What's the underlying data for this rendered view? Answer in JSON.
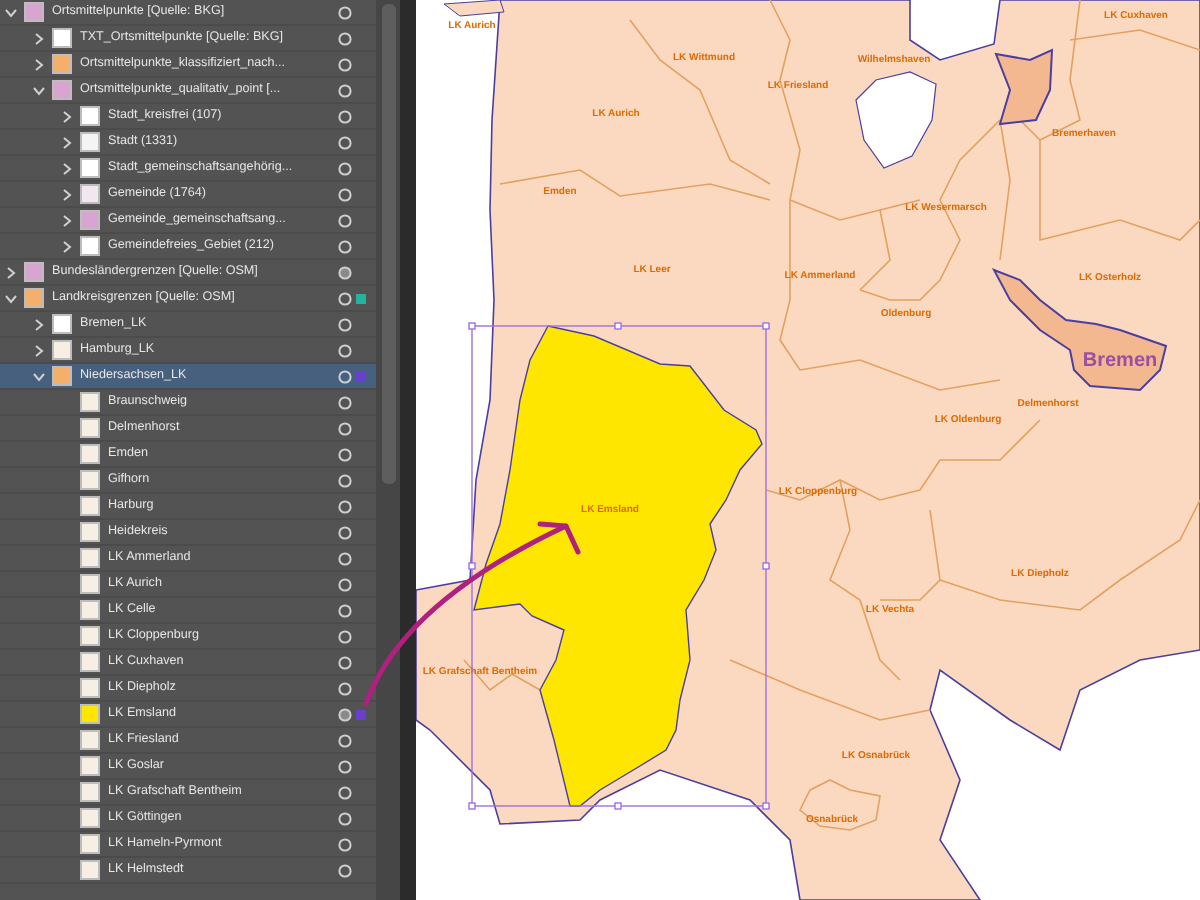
{
  "layers_panel": {
    "layers": [
      {
        "name": "Ortsmittelpunkte [Quelle: BKG]",
        "expanded": true,
        "selected": false,
        "thumb": {
          "color": "#d9a5d0"
        },
        "children": [
          {
            "name": "TXT_Ortsmittelpunkte [Quelle: BKG]",
            "expanded": false,
            "selected": false,
            "thumb": {
              "color": "#ffffff"
            }
          },
          {
            "name": "Ortsmittelpunkte_klassifiziert_nach...",
            "expanded": false,
            "selected": false,
            "thumb": {
              "color": "#f4b06a"
            }
          },
          {
            "name": "Ortsmittelpunkte_qualitativ_point [...",
            "expanded": true,
            "selected": false,
            "thumb": {
              "color": "#d9a5d0"
            },
            "children": [
              {
                "name": "Stadt_kreisfrei (107)",
                "expanded": false,
                "selected": false,
                "thumb": {
                  "color": "#ffffff"
                }
              },
              {
                "name": "Stadt (1331)",
                "expanded": false,
                "selected": false,
                "thumb": {
                  "color": "#f4f4f4"
                }
              },
              {
                "name": "Stadt_gemeinschaftsangehörig...",
                "expanded": false,
                "selected": false,
                "thumb": {
                  "color": "#ffffff"
                }
              },
              {
                "name": "Gemeinde (1764)",
                "expanded": false,
                "selected": false,
                "thumb": {
                  "color": "#f2e6f0"
                }
              },
              {
                "name": "Gemeinde_gemeinschaftsang...",
                "expanded": false,
                "selected": false,
                "thumb": {
                  "color": "#d9a5d0"
                }
              },
              {
                "name": "Gemeindefreies_Gebiet (212)",
                "expanded": false,
                "selected": false,
                "thumb": {
                  "color": "#ffffff"
                }
              }
            ]
          }
        ]
      },
      {
        "name": "Bundesländergrenzen [Quelle: OSM]",
        "expanded": false,
        "selected": false,
        "targeted": true,
        "thumb": {
          "color": "#d9a5d0"
        }
      },
      {
        "name": "Landkreisgrenzen [Quelle: OSM]",
        "expanded": true,
        "selected": false,
        "selection": {
          "color": "#21b5a0"
        },
        "thumb": {
          "color": "#f4b06a"
        },
        "children": [
          {
            "name": "Bremen_LK",
            "expanded": false,
            "selected": false,
            "thumb": {
              "color": "#ffffff"
            }
          },
          {
            "name": "Hamburg_LK",
            "expanded": false,
            "selected": false,
            "thumb": {
              "color": "#f7efe3"
            }
          },
          {
            "name": "Niedersachsen_LK",
            "expanded": true,
            "selected": true,
            "selection": {
              "color": "#6a3fd0"
            },
            "thumb": {
              "color": "#f4b06a"
            },
            "children": [
              {
                "name": "Braunschweig",
                "selected": false,
                "thumb": {
                  "color": "#f7efe3"
                }
              },
              {
                "name": "Delmenhorst",
                "selected": false,
                "thumb": {
                  "color": "#f7efe3"
                }
              },
              {
                "name": "Emden",
                "selected": false,
                "thumb": {
                  "color": "#f7efe3"
                }
              },
              {
                "name": "Gifhorn",
                "selected": false,
                "thumb": {
                  "color": "#f7efe3"
                }
              },
              {
                "name": "Harburg",
                "selected": false,
                "thumb": {
                  "color": "#f7efe3"
                }
              },
              {
                "name": "Heidekreis",
                "selected": false,
                "thumb": {
                  "color": "#f7efe3"
                }
              },
              {
                "name": "LK Ammerland",
                "selected": false,
                "thumb": {
                  "color": "#f7efe3"
                }
              },
              {
                "name": "LK Aurich",
                "selected": false,
                "thumb": {
                  "color": "#f7efe3"
                }
              },
              {
                "name": "LK Celle",
                "selected": false,
                "thumb": {
                  "color": "#f7efe3"
                }
              },
              {
                "name": "LK Cloppenburg",
                "selected": false,
                "thumb": {
                  "color": "#f7efe3"
                }
              },
              {
                "name": "LK Cuxhaven",
                "selected": false,
                "thumb": {
                  "color": "#f7efe3"
                }
              },
              {
                "name": "LK Diepholz",
                "selected": false,
                "thumb": {
                  "color": "#f7efe3"
                }
              },
              {
                "name": "LK Emsland",
                "selected": false,
                "targeted": true,
                "selection": {
                  "color": "#6a3fd0"
                },
                "thumb": {
                  "color": "#ffe600"
                }
              },
              {
                "name": "LK Friesland",
                "selected": false,
                "thumb": {
                  "color": "#f7efe3"
                }
              },
              {
                "name": "LK Goslar",
                "selected": false,
                "thumb": {
                  "color": "#f7efe3"
                }
              },
              {
                "name": "LK Grafschaft Bentheim",
                "selected": false,
                "thumb": {
                  "color": "#f7efe3"
                }
              },
              {
                "name": "LK Göttingen",
                "selected": false,
                "thumb": {
                  "color": "#f7efe3"
                }
              },
              {
                "name": "LK Hameln-Pyrmont",
                "selected": false,
                "thumb": {
                  "color": "#f7efe3"
                }
              },
              {
                "name": "LK Helmstedt",
                "selected": false,
                "thumb": {
                  "color": "#f7efe3"
                }
              }
            ]
          }
        ]
      }
    ]
  },
  "map": {
    "labels": [
      {
        "text": "LK Aurich",
        "kind": "district"
      },
      {
        "text": "LK Wittmund",
        "kind": "district"
      },
      {
        "text": "LK Friesland",
        "kind": "district"
      },
      {
        "text": "Wilhelmshaven",
        "kind": "district"
      },
      {
        "text": "LK Cuxhaven",
        "kind": "district"
      },
      {
        "text": "Bremerhaven",
        "kind": "district"
      },
      {
        "text": "LK Aurich",
        "kind": "district"
      },
      {
        "text": "Emden",
        "kind": "district"
      },
      {
        "text": "LK Wesermarsch",
        "kind": "district"
      },
      {
        "text": "LK Leer",
        "kind": "district"
      },
      {
        "text": "LK Ammerland",
        "kind": "district"
      },
      {
        "text": "LK Osterholz",
        "kind": "district"
      },
      {
        "text": "Oldenburg",
        "kind": "district"
      },
      {
        "text": "Bremen",
        "kind": "state"
      },
      {
        "text": "Delmenhorst",
        "kind": "district"
      },
      {
        "text": "LK Oldenburg",
        "kind": "district"
      },
      {
        "text": "LK Cloppenburg",
        "kind": "district"
      },
      {
        "text": "LK Emsland",
        "kind": "district"
      },
      {
        "text": "LK Diepholz",
        "kind": "district"
      },
      {
        "text": "LK Vechta",
        "kind": "district"
      },
      {
        "text": "LK Grafschaft Bentheim",
        "kind": "district"
      },
      {
        "text": "LK Osnabrück",
        "kind": "district"
      },
      {
        "text": "Osnabrück",
        "kind": "district"
      }
    ]
  }
}
